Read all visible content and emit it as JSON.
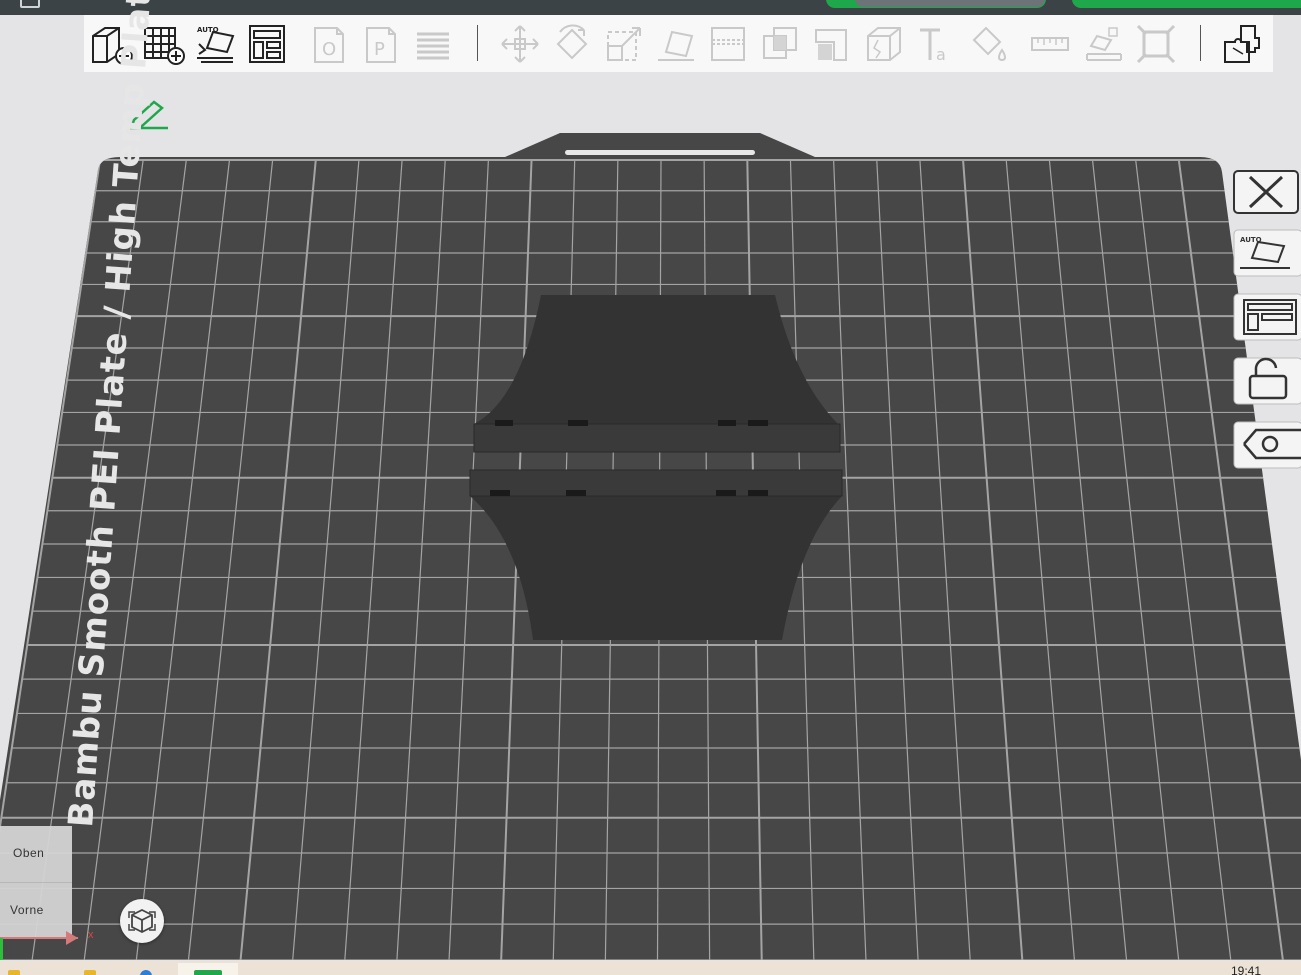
{
  "window": {
    "title_bar_icon": "menu-icon"
  },
  "toolbar": {
    "buttons": [
      {
        "name": "add-object",
        "icon": "cube-plus-icon"
      },
      {
        "name": "add-plate",
        "icon": "grid-plus-icon"
      },
      {
        "name": "auto-orient",
        "icon": "auto-orient-icon",
        "badge": "AUTO"
      },
      {
        "name": "arrange",
        "icon": "arrange-icon"
      },
      {
        "name": "slice-plate",
        "icon": "plate-o-icon",
        "glyph": "O"
      },
      {
        "name": "print-plate",
        "icon": "plate-p-icon",
        "glyph": "P"
      },
      {
        "name": "layers",
        "icon": "layers-icon"
      },
      {
        "name": "move",
        "icon": "move-icon"
      },
      {
        "name": "rotate",
        "icon": "rotate-icon"
      },
      {
        "name": "scale",
        "icon": "scale-icon"
      },
      {
        "name": "lay-on-face",
        "icon": "lay-on-face-icon"
      },
      {
        "name": "cut",
        "icon": "cut-icon"
      },
      {
        "name": "boolean",
        "icon": "boolean-icon"
      },
      {
        "name": "support-paint",
        "icon": "support-paint-icon"
      },
      {
        "name": "seam-paint",
        "icon": "seam-paint-icon"
      },
      {
        "name": "text",
        "icon": "text-icon",
        "glyph": "Ta"
      },
      {
        "name": "color-paint",
        "icon": "paint-bucket-icon"
      },
      {
        "name": "measure",
        "icon": "ruler-icon"
      },
      {
        "name": "assembly",
        "icon": "assembly-icon"
      },
      {
        "name": "explode",
        "icon": "explode-icon"
      },
      {
        "name": "split",
        "icon": "split-parts-icon"
      }
    ]
  },
  "plate": {
    "label": "Bambu Smooth PEI Plate / High Temp Plate"
  },
  "right_panel": {
    "buttons": [
      {
        "name": "delete-plate",
        "icon": "close-icon"
      },
      {
        "name": "auto-orient-plate",
        "icon": "auto-orient-icon",
        "badge": "AUTO"
      },
      {
        "name": "arrange-plate",
        "icon": "arrange-icon"
      },
      {
        "name": "lock-plate",
        "icon": "lock-icon"
      },
      {
        "name": "plate-settings",
        "icon": "gear-icon"
      }
    ]
  },
  "view_cube": {
    "top": "Oben",
    "front": "Vorne"
  },
  "axis": {
    "x_label": "x"
  },
  "taskbar": {
    "clock": "19:41"
  },
  "colors": {
    "plate_bg": "#474747",
    "grid": "#b5b5b5",
    "model": "#333333",
    "accent": "#1fa84b",
    "toolbar_bg": "#f8f8f8"
  }
}
